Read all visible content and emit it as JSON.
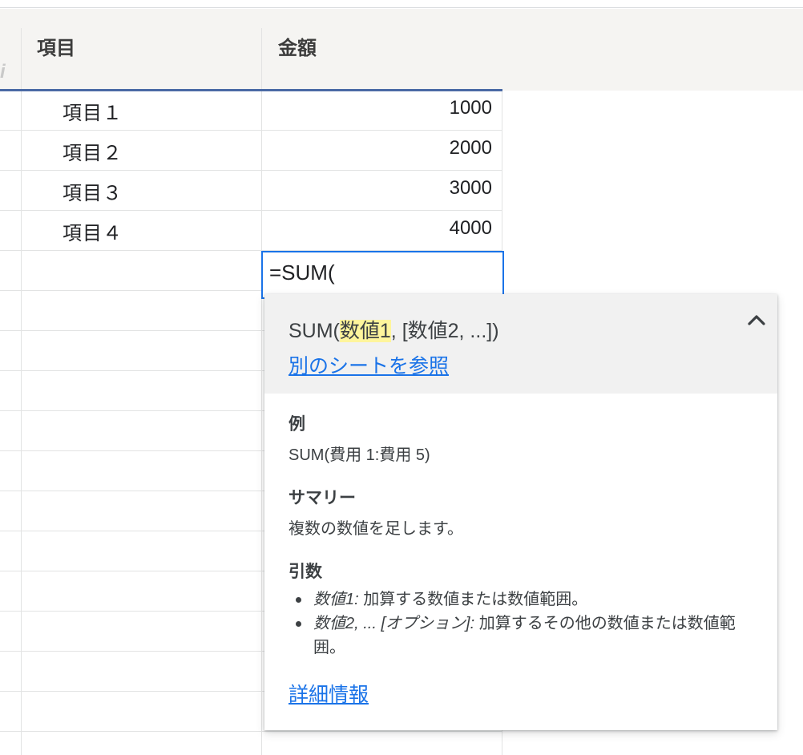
{
  "columns": {
    "item_header": "項目",
    "amount_header": "金額",
    "prev_header_partial": "i"
  },
  "rows": [
    {
      "item": "項目１",
      "amount": "1000"
    },
    {
      "item": "項目２",
      "amount": "2000"
    },
    {
      "item": "項目３",
      "amount": "3000"
    },
    {
      "item": "項目４",
      "amount": "4000"
    }
  ],
  "editor": {
    "formula": "=SUM("
  },
  "popup": {
    "signature_prefix": "SUM(",
    "signature_active_arg": "数値1",
    "signature_suffix": ", [数値2, ...])",
    "sheet_link": "別のシートを参照",
    "example_title": "例",
    "example_text": "SUM(費用 1:費用 5)",
    "summary_title": "サマリー",
    "summary_text": "複数の数値を足します。",
    "args_title": "引数",
    "args": [
      {
        "name": "数値1:",
        "desc": " 加算する数値または数値範囲。"
      },
      {
        "name": "数値2, ... [オプション]:",
        "desc": " 加算するその他の数値または数値範囲。"
      }
    ],
    "more_link": "詳細情報",
    "collapse_icon": "chevron-up-icon"
  },
  "colors": {
    "selection_border": "#1a73e8",
    "header_rule": "#4a6aa5",
    "arg_highlight": "#fef59c",
    "link": "#1a73e8"
  }
}
